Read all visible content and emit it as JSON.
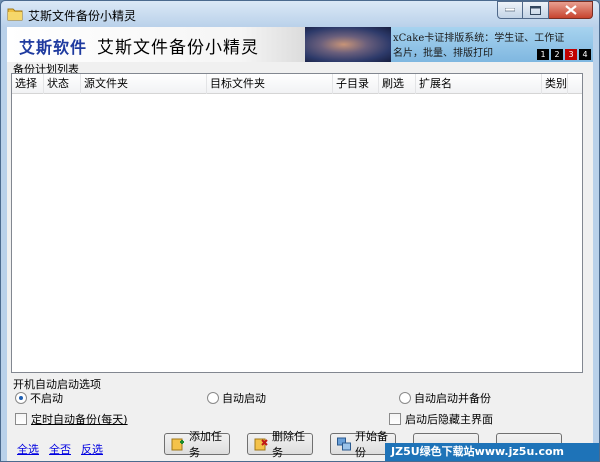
{
  "window": {
    "title": "艾斯文件备份小精灵"
  },
  "banner": {
    "brand": "艾斯软件",
    "app_name": "艾斯文件备份小精灵",
    "ad_line1": "xCake卡证排版系统：学生证、工作证",
    "ad_line2": "名片，批量、排版打印",
    "ad_pages": [
      "1",
      "2",
      "3",
      "4"
    ],
    "ad_selected": 2
  },
  "list": {
    "caption": "备份计划列表",
    "columns": [
      "选择",
      "状态",
      "源文件夹",
      "目标文件夹",
      "子目录",
      "刷选",
      "扩展名",
      "类别"
    ]
  },
  "startup": {
    "caption": "开机自动启动选项",
    "options": [
      "不启动",
      "自动启动",
      "自动启动并备份"
    ],
    "selected": 0
  },
  "checkboxes": {
    "daily_backup": "定时自动备份(每天)",
    "hide_main": "启动后隐藏主界面"
  },
  "links": {
    "select_all": "全选",
    "select_none": "全否",
    "invert": "反选"
  },
  "buttons": {
    "add_task": "添加任务",
    "delete_task": "删除任务",
    "start_backup": "开始备份"
  },
  "watermark": "JZ5U绿色下载站www.jz5u.com"
}
